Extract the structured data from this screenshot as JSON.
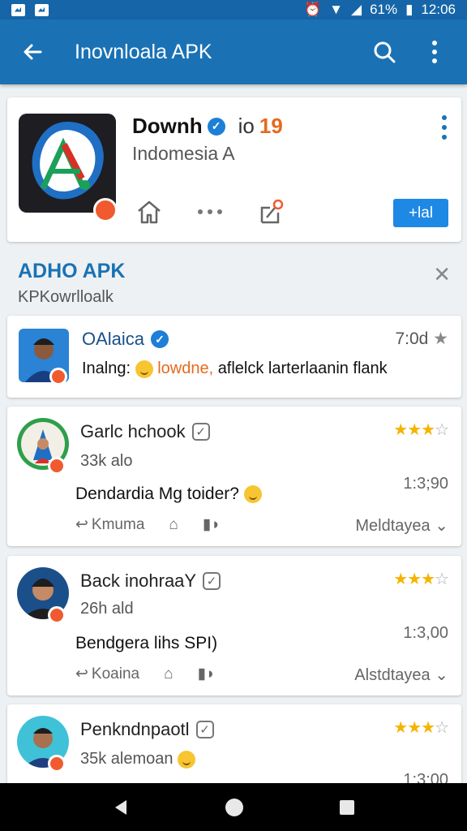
{
  "status_bar": {
    "battery": "61%",
    "time": "12:06"
  },
  "app_bar": {
    "title": "Inovnloala APK"
  },
  "app_card": {
    "name": "Downh",
    "version": "io",
    "count": "19",
    "subtitle": "Indomesia A",
    "install_label": "+lal"
  },
  "section": {
    "title": "ADHO APK",
    "subtitle": "KPKowrlloalk"
  },
  "reviews": [
    {
      "name": "OAlaica",
      "time": "7:0d",
      "body": "Inalng:",
      "body_highlight": "lowdne,",
      "body_rest": "aflelck larterlaanin flank"
    },
    {
      "name": "Garlc hchook",
      "meta": "33k alo",
      "body": "Dendardia Mg toider?",
      "time": "1:3;90",
      "reply_label": "Kmuma",
      "filter_label": "Meldtayea"
    },
    {
      "name": "Back inohraaY",
      "meta": "26h ald",
      "body": "Bendgera lihs SPI)",
      "time": "1:3,00",
      "reply_label": "Koaina",
      "filter_label": "Alstdtayea"
    },
    {
      "name": "Penkndnpaotl",
      "meta": "35k alemoan",
      "time": "1:3:00"
    }
  ],
  "colors": {
    "primary": "#1a72b5",
    "accent": "#e66a1e",
    "star": "#f4b400"
  }
}
